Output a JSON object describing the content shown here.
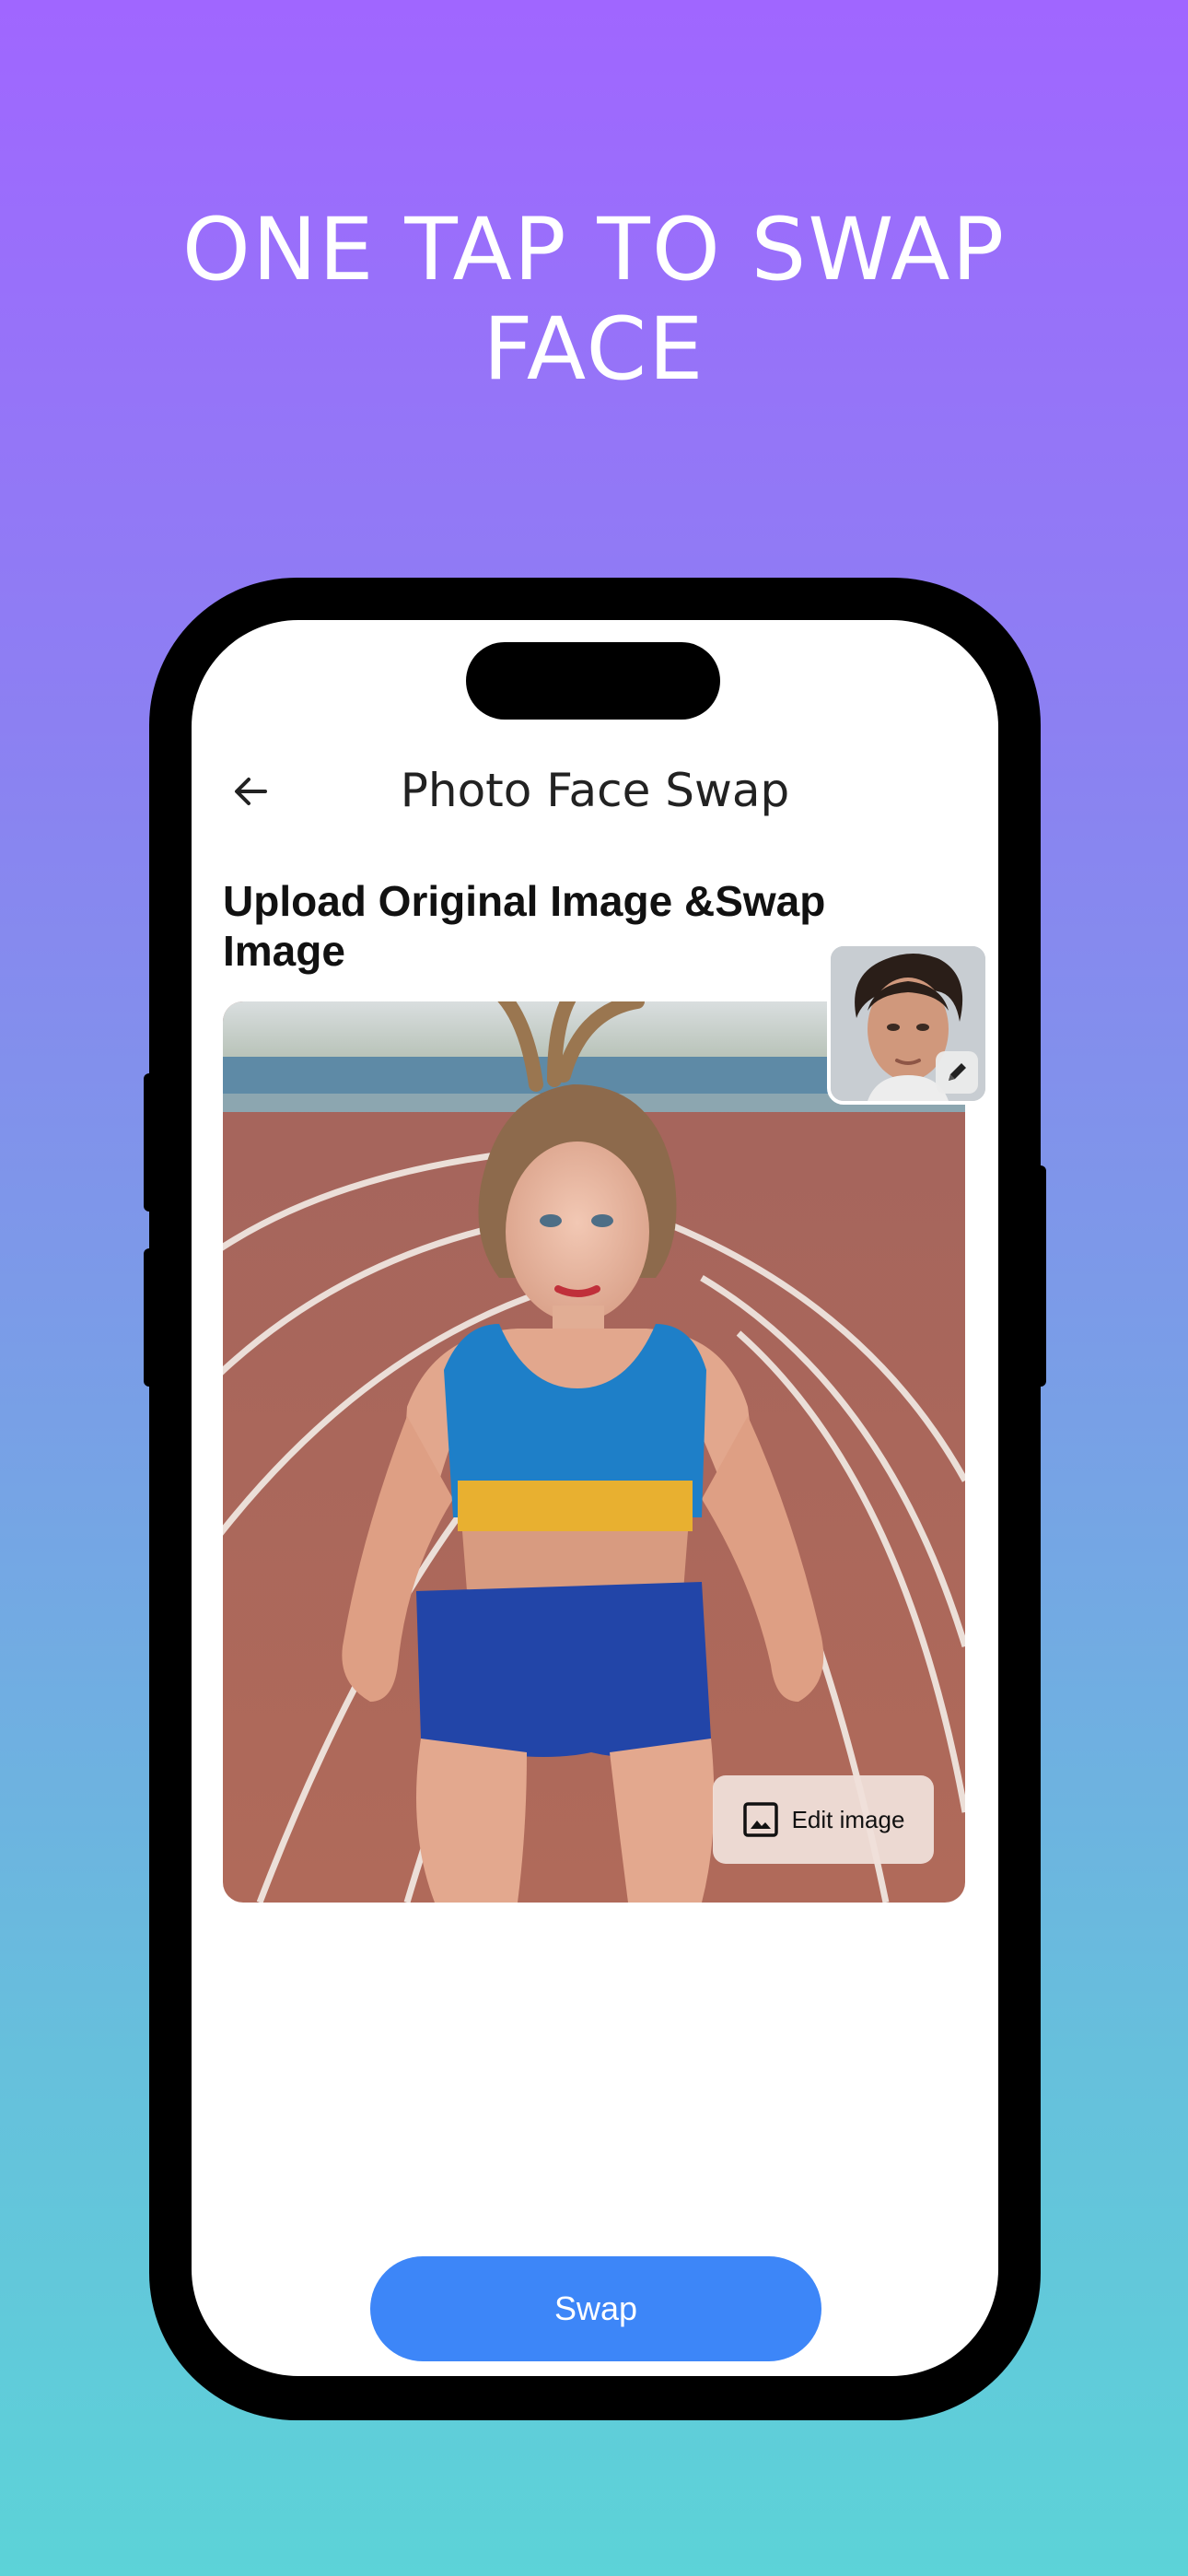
{
  "promo": {
    "title_line1": "ONE TAP TO SWAP",
    "title_line2": "FACE"
  },
  "app": {
    "nav_title": "Photo Face Swap",
    "section_title": "Upload Original Image &Swap Image",
    "edit_image_label": "Edit image",
    "swap_label": "Swap"
  },
  "icons": {
    "back": "arrow-left-icon",
    "edit_image": "image-icon",
    "thumb_edit": "pencil-icon"
  },
  "colors": {
    "gradient_top": "#A066FF",
    "gradient_bottom": "#5CD3D8",
    "swap_button": "#3D86F8",
    "edit_button_bg": "#F0E0DA"
  }
}
